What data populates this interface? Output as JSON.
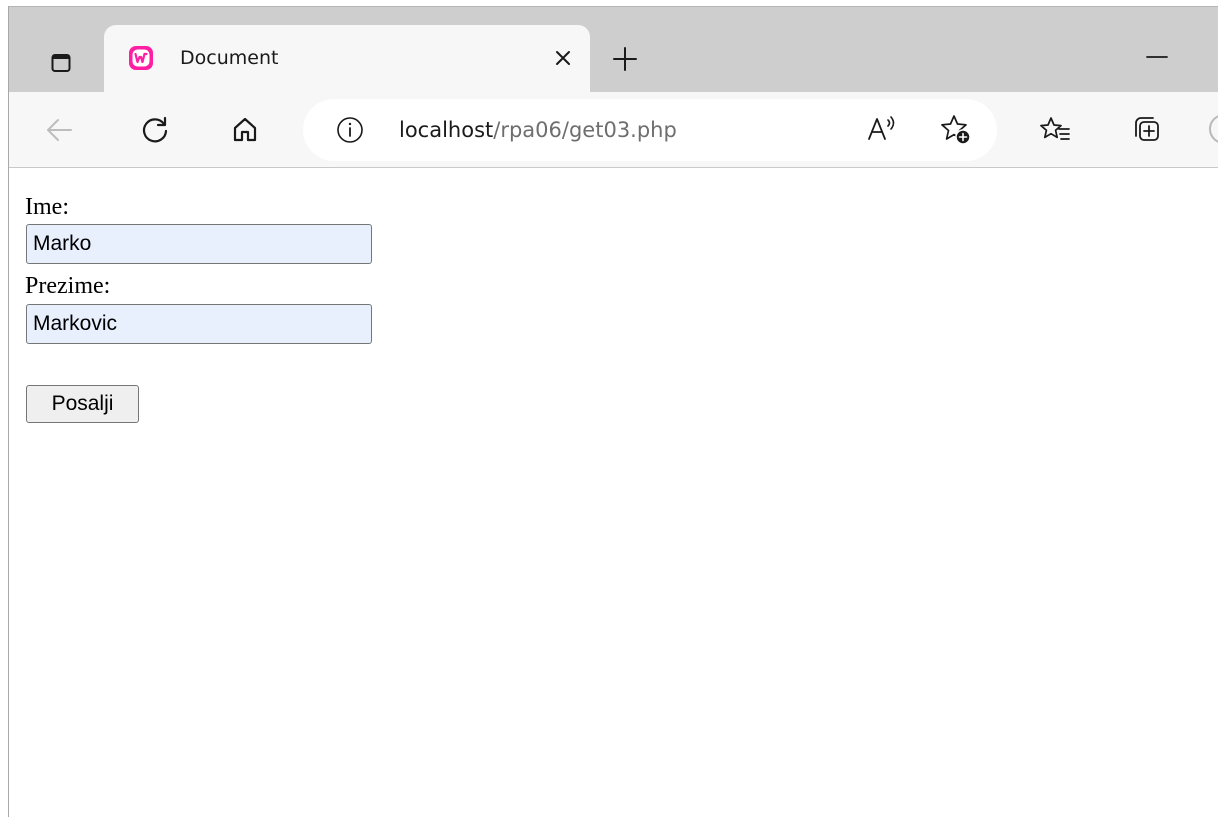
{
  "browser": {
    "tab": {
      "title": "Document",
      "favicon": "wampserver-icon"
    },
    "address": {
      "host": "localhost",
      "path": "/rpa06/get03.php"
    },
    "accent_color": "#ff1fa2"
  },
  "form": {
    "first_name_label": "Ime:",
    "first_name_value": "Marko",
    "last_name_label": "Prezime:",
    "last_name_value": "Markovic",
    "submit_label": "Posalji"
  }
}
